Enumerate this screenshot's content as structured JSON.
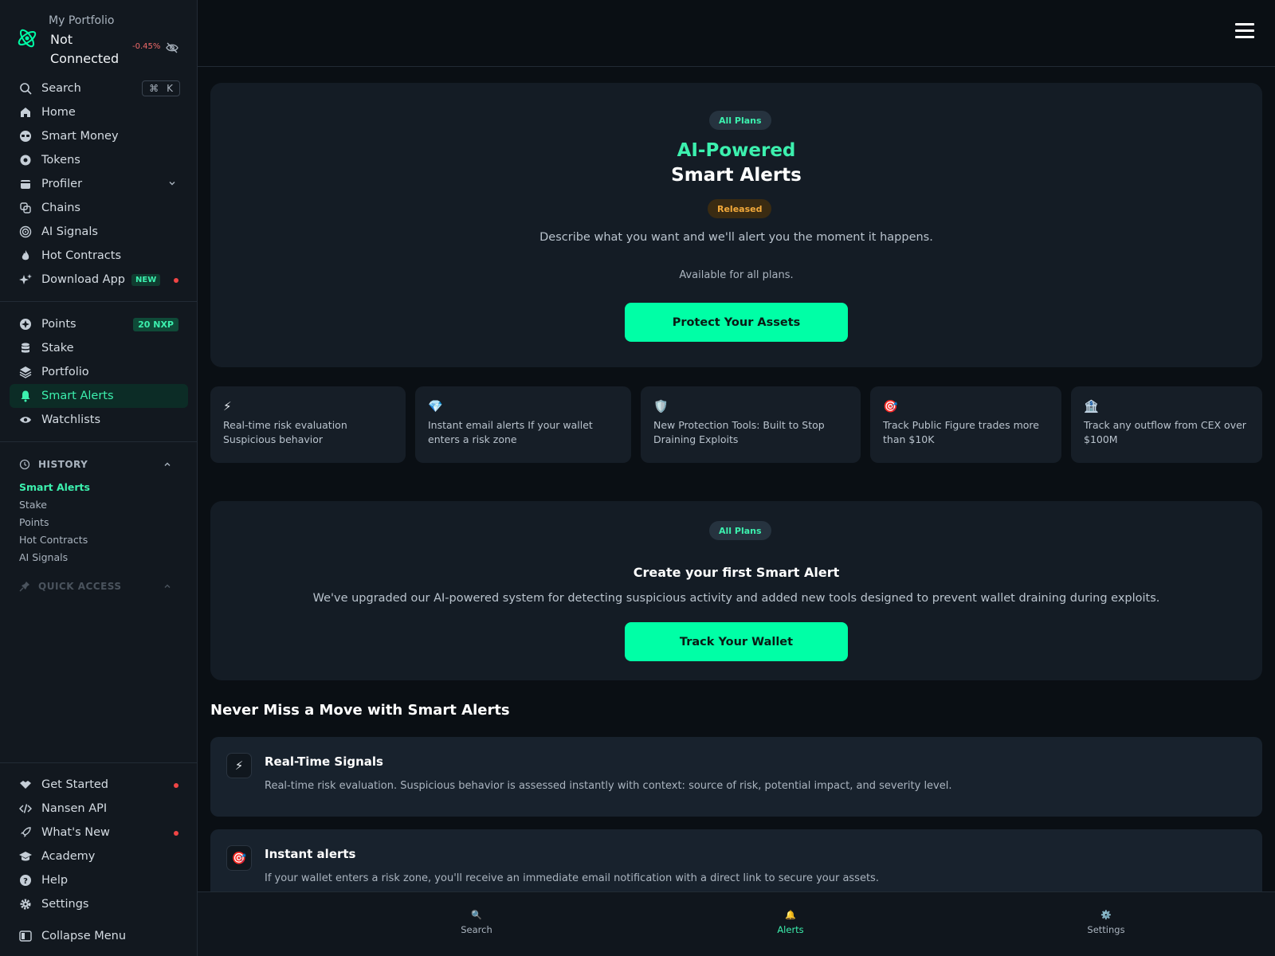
{
  "sidebar": {
    "portfolio_title": "My Portfolio",
    "portfolio_status": "Not Connected",
    "portfolio_change": "-0.45%",
    "search": {
      "label": "Search",
      "shortcut_symbol": "⌘",
      "shortcut_key": "K"
    },
    "nav_main": [
      {
        "label": "Home",
        "icon": "home-icon"
      },
      {
        "label": "Smart Money",
        "icon": "glasses-icon"
      },
      {
        "label": "Tokens",
        "icon": "token-icon"
      },
      {
        "label": "Profiler",
        "icon": "wallet-icon"
      },
      {
        "label": "Chains",
        "icon": "chains-icon"
      },
      {
        "label": "AI Signals",
        "icon": "target-icon"
      },
      {
        "label": "Hot Contracts",
        "icon": "flame-icon"
      },
      {
        "label": "Download App",
        "icon": "sparkle-icon",
        "badge": "NEW"
      }
    ],
    "nav_secondary": [
      {
        "label": "Points",
        "icon": "points-icon",
        "badge": "20 NXP"
      },
      {
        "label": "Stake",
        "icon": "database-icon"
      },
      {
        "label": "Portfolio",
        "icon": "layers-icon"
      },
      {
        "label": "Smart Alerts",
        "icon": "bell-icon",
        "active": true
      },
      {
        "label": "Watchlists",
        "icon": "eye-icon"
      }
    ],
    "history": {
      "title": "HISTORY",
      "items": [
        "Smart Alerts",
        "Stake",
        "Points",
        "Hot Contracts",
        "AI Signals"
      ]
    },
    "quick_access": {
      "title": "QUICK ACCESS"
    },
    "nav_footer": [
      {
        "label": "Get Started",
        "icon": "handshake-icon",
        "dot": true
      },
      {
        "label": "Nansen API",
        "icon": "code-icon"
      },
      {
        "label": "What's New",
        "icon": "rocket-icon",
        "dot": true
      },
      {
        "label": "Academy",
        "icon": "graduation-cap-icon"
      },
      {
        "label": "Help",
        "icon": "help-icon"
      },
      {
        "label": "Settings",
        "icon": "gear-icon"
      }
    ],
    "collapse_label": "Collapse Menu"
  },
  "hero": {
    "plan_badge": "All Plans",
    "title_accent": "AI-Powered",
    "title_main": "Smart Alerts",
    "status_badge": "Released",
    "description": "Describe what you want and we'll alert you the moment it happens.",
    "availability": "Available for all plans.",
    "cta": "Protect Your Assets"
  },
  "features": [
    {
      "icon": "⚡",
      "text": "Real-time risk evaluation Suspicious behavior"
    },
    {
      "icon": "💎",
      "text": "Instant email alerts If your wallet enters a risk zone"
    },
    {
      "icon": "🛡️",
      "text": "New Protection Tools: Built to Stop Draining Exploits"
    },
    {
      "icon": "🎯",
      "text": "Track Public Figure trades more than $10K"
    },
    {
      "icon": "🏦",
      "text": "Track any outflow from CEX over $100M"
    }
  ],
  "create_card": {
    "plan_badge": "All Plans",
    "title": "Create your first Smart Alert",
    "description": "We've upgraded our AI-powered system for detecting suspicious activity and added new tools designed to prevent wallet draining during exploits.",
    "cta": "Track Your Wallet"
  },
  "section": {
    "title": "Never Miss a Move with Smart Alerts",
    "rows": [
      {
        "icon": "⚡",
        "title": "Real-Time Signals",
        "text": "Real-time risk evaluation. Suspicious behavior is assessed instantly with context: source of risk, potential impact, and severity level."
      },
      {
        "icon": "🎯",
        "title": "Instant alerts",
        "text": "If your wallet enters a risk zone, you'll receive an immediate email notification with a direct link to secure your assets."
      }
    ]
  },
  "bottom_nav": [
    {
      "icon": "🔍",
      "label": "Search"
    },
    {
      "icon": "🔔",
      "label": "Alerts",
      "active": true
    },
    {
      "icon": "⚙️",
      "label": "Settings"
    }
  ],
  "colors": {
    "accent": "#00ffa6",
    "accent_text": "#3cf0ae",
    "background": "#0a0f14",
    "panel": "#141c25",
    "negative": "#f06a6a",
    "released": "#f2a93b"
  }
}
